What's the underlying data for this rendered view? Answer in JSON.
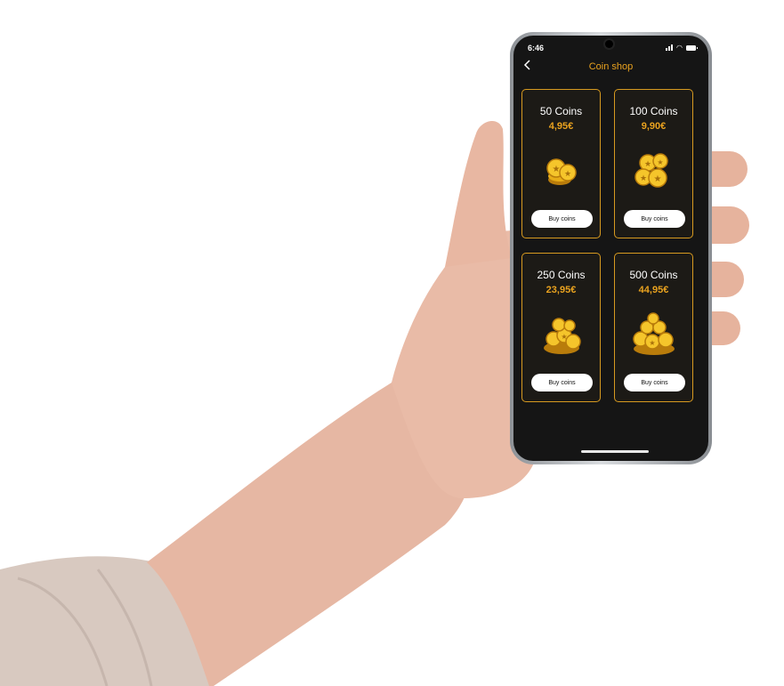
{
  "status_bar": {
    "time": "6:46"
  },
  "header": {
    "title": "Coin shop",
    "back_icon": "chevron-left-icon"
  },
  "products": [
    {
      "title": "50 Coins",
      "price": "4,95€",
      "button": "Buy coins"
    },
    {
      "title": "100 Coins",
      "price": "9,90€",
      "button": "Buy coins"
    },
    {
      "title": "250 Coins",
      "price": "23,95€",
      "button": "Buy coins"
    },
    {
      "title": "500 Coins",
      "price": "44,95€",
      "button": "Buy coins"
    }
  ],
  "colors": {
    "accent": "#e9a21f",
    "background": "#151515",
    "card_border": "#d79a20"
  }
}
